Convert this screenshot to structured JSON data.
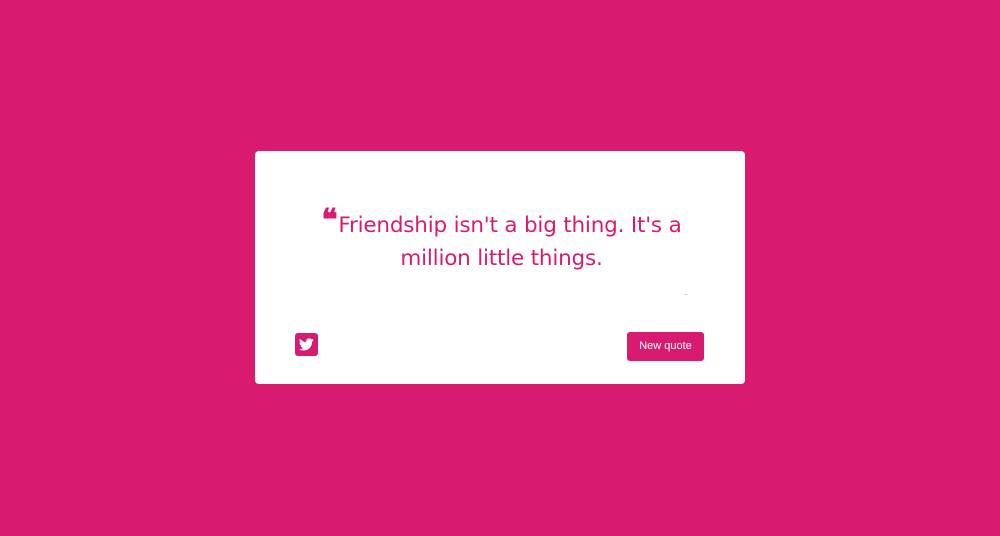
{
  "colors": {
    "background": "#d81b70",
    "card": "#ffffff",
    "accent": "#d81b70"
  },
  "quote": {
    "mark": "❝",
    "text": "Friendship isn't a big thing. It's a million little things.",
    "author": "-"
  },
  "actions": {
    "tweet_icon": "twitter-icon",
    "new_quote_label": "New quote"
  }
}
